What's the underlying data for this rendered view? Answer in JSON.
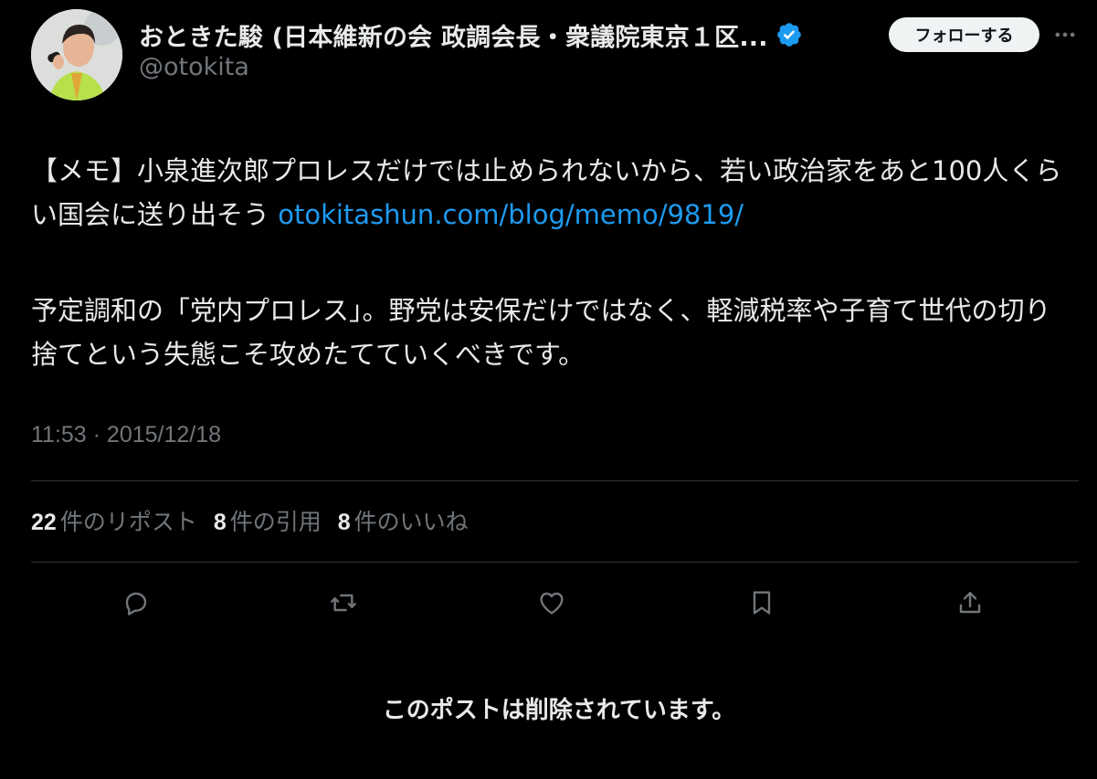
{
  "author": {
    "display_name": "おときた駿 (日本維新の会 政調会長・衆議院東京１区...",
    "handle": "@otokita",
    "verified_color": "#1d9bf0"
  },
  "header": {
    "follow_label": "フォローする",
    "more_icon": "more-horizontal-icon"
  },
  "post": {
    "text_line1_before_link": "【メモ】小泉進次郎プロレスだけでは止められないから、若い政治家をあと100人くらい国会に送り出そう ",
    "link_text": "otokitashun.com/blog/memo/9819/",
    "text_para2": "予定調和の「党内プロレス」。野党は安保だけではなく、軽減税率や子育て世代の切り捨てという失態こそ攻めたてていくべきです。",
    "timestamp": "11:53 · 2015/12/18"
  },
  "stats": {
    "reposts_count": "22",
    "reposts_label": "件のリポスト",
    "quotes_count": "8",
    "quotes_label": "件の引用",
    "likes_count": "8",
    "likes_label": "件のいいね"
  },
  "actions": [
    "reply-icon",
    "repost-icon",
    "like-icon",
    "bookmark-icon",
    "share-icon"
  ],
  "deleted_notice": "このポストは削除されています。",
  "colors": {
    "background": "#000000",
    "text": "#e7e9ea",
    "muted": "#71767b",
    "link": "#1d9bf0",
    "divider": "#2f3336"
  }
}
